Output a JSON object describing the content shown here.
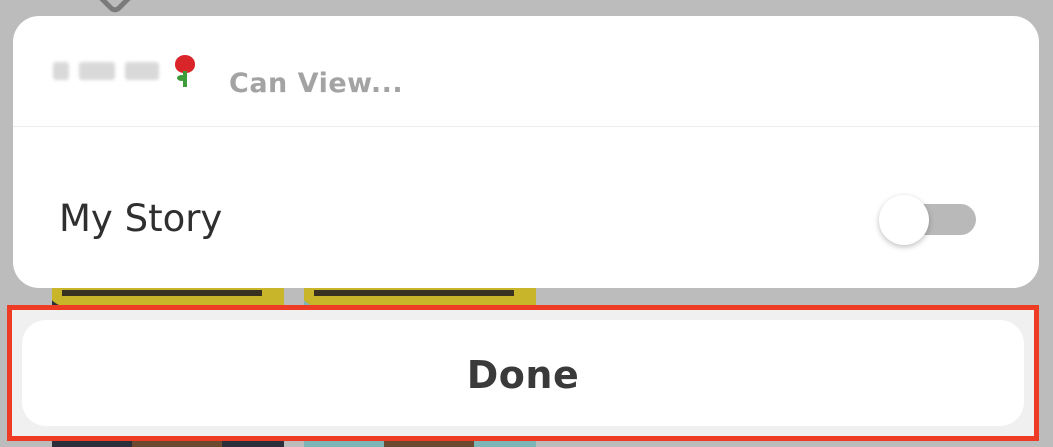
{
  "sheet": {
    "header_title": "Can View...",
    "row_label": "My Story",
    "toggle_state": "off"
  },
  "done_button": {
    "label": "Done"
  },
  "colors": {
    "highlight_border": "#ee3b24",
    "toggle_track": "#b9b9b9",
    "rose": "#d9252a"
  }
}
